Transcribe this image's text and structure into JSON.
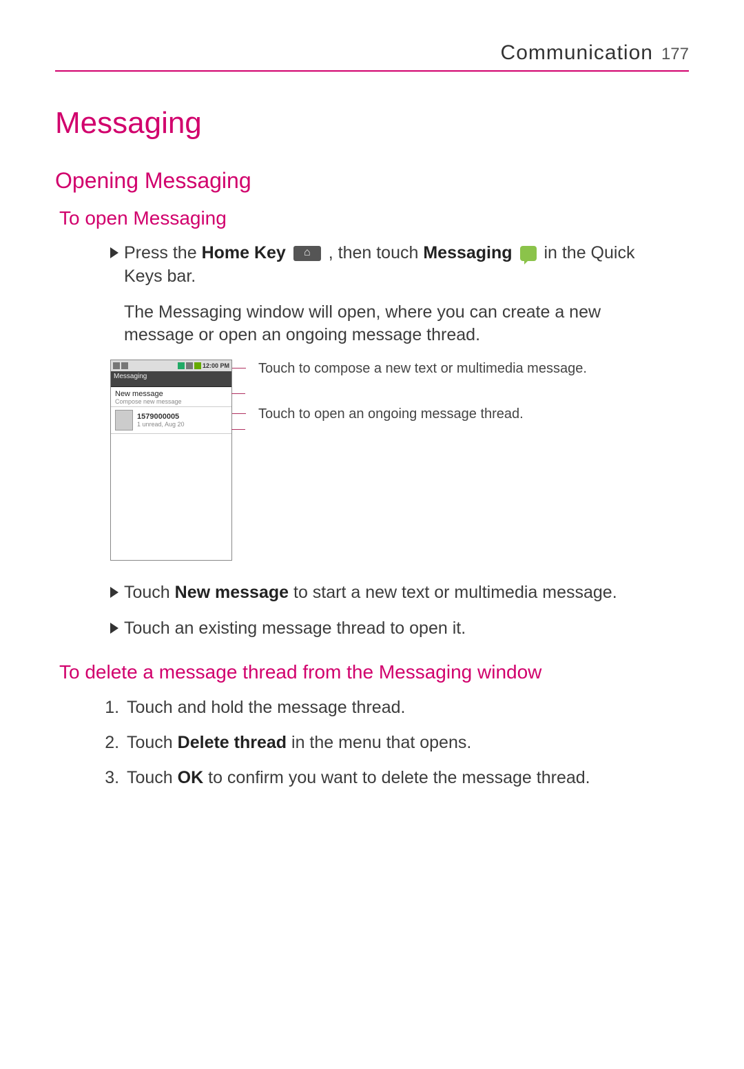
{
  "header": {
    "section": "Communication",
    "page": "177"
  },
  "h1": "Messaging",
  "h2": "Opening Messaging",
  "sub1": "To open Messaging",
  "intro": {
    "a": "Press the ",
    "home_key": "Home Key",
    "b": " , then touch ",
    "messaging": "Messaging",
    "c": " in the Quick Keys bar."
  },
  "para2": "The Messaging window will open, where you can create a new message or open an ongoing message thread.",
  "phone": {
    "time": "12:00 PM",
    "title": "Messaging",
    "new_msg": "New message",
    "compose": "Compose new message",
    "thread_name": "1579000005",
    "thread_sub": "1 unread,   Aug 20"
  },
  "callout1": "Touch to compose a new text or multimedia message.",
  "callout2": "Touch to open an ongoing message thread.",
  "bullet2": {
    "a": "Touch ",
    "b": "New message",
    "c": " to start a new text or multimedia message."
  },
  "bullet3": "Touch an existing message thread to open it.",
  "sub2": "To delete a message thread from the Messaging window",
  "steps": {
    "s1": "Touch and hold the message thread.",
    "s2a": "Touch ",
    "s2b": "Delete thread",
    "s2c": " in the menu that opens.",
    "s3a": "Touch ",
    "s3b": "OK",
    "s3c": " to confirm you want to delete the message thread."
  }
}
